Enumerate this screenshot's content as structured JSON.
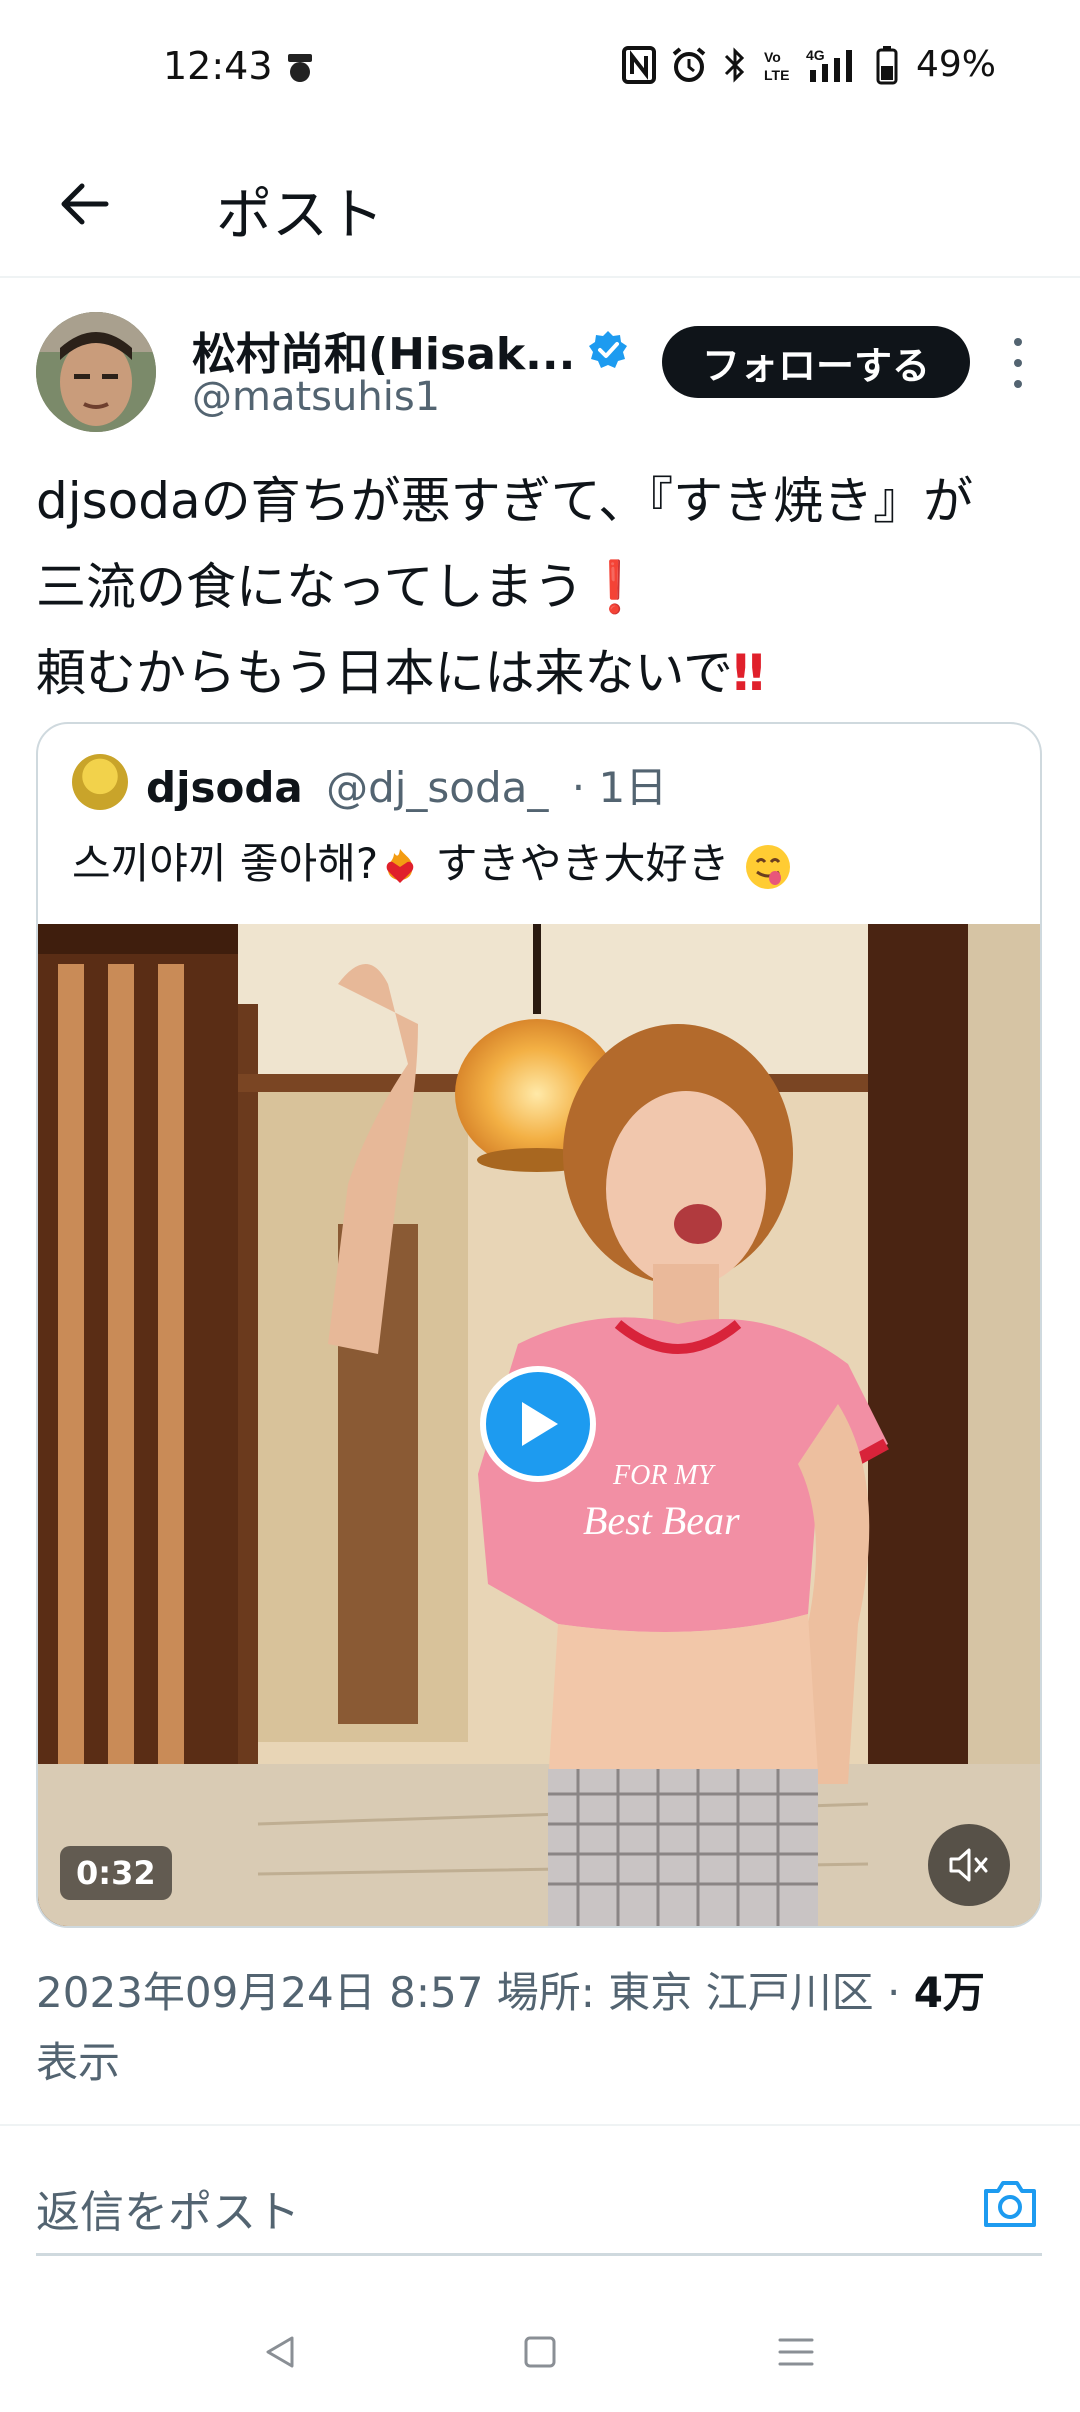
{
  "status_bar": {
    "time": "12:43",
    "battery_text": "49%",
    "network_label": "4G"
  },
  "header": {
    "title": "ポスト",
    "back_icon": "arrow-left-icon"
  },
  "author": {
    "name": "松村尚和(Hisak...",
    "handle": "@matsuhis1",
    "verified": true,
    "follow_label": "フォローする"
  },
  "post": {
    "lines": [
      "djsodaの育ちが悪すぎて、『すき焼き』が",
      "三流の食になってしまう",
      "頼むからもう日本には来ないで"
    ],
    "line2_mark": "❗",
    "line3_mark": "‼"
  },
  "quote": {
    "name": "djsoda",
    "handle": "@dj_soda_",
    "time": "· 1日",
    "text_part1": "스끼야끼 좋아해?",
    "text_part2": " すきやき大好き ",
    "video": {
      "duration": "0:32",
      "shirt_text_1": "FOR MY",
      "shirt_text_2": "Best Bear"
    }
  },
  "meta": {
    "datetime_location": "2023年09月24日 8:57 場所: 東京 江戸川区 · ",
    "views_count": "4万",
    "views_label": "表示"
  },
  "reply": {
    "placeholder": "返信をポスト"
  },
  "colors": {
    "accent": "#1d9bf0",
    "text_primary": "#0f1419",
    "text_secondary": "#536471",
    "border": "#cfd9de",
    "alert_red": "#e0202b"
  }
}
